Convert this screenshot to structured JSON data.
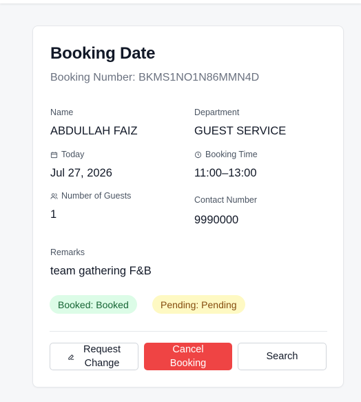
{
  "card": {
    "title": "Booking Date",
    "booking_number": "Booking Number: BKMS1NO1N86MMN4D"
  },
  "fields": {
    "name": {
      "label": "Name",
      "value": "ABDULLAH FAIZ"
    },
    "department": {
      "label": "Department",
      "value": "GUEST SERVICE"
    },
    "date": {
      "label": "Today",
      "value": "Jul 27, 2026",
      "icon": "calendar-icon"
    },
    "time": {
      "label": "Booking Time",
      "value": "11:00–13:00",
      "icon": "clock-icon"
    },
    "guests": {
      "label": "Number of Guests",
      "value": "1",
      "icon": "users-icon"
    },
    "contact": {
      "label": "Contact Number",
      "value": "9990000"
    },
    "remarks": {
      "label": "Remarks",
      "value": "team gathering F&B"
    }
  },
  "badges": {
    "booked": {
      "text": "Booked: Booked",
      "bg": "#dcfce7",
      "fg": "#166534"
    },
    "pending": {
      "text": "Pending: Pending",
      "bg": "#fef9c3",
      "fg": "#854d0e"
    }
  },
  "actions": {
    "request_line1": "Request",
    "request_line2": "Change",
    "request_icon": "edit-icon",
    "cancel_line1": "Cancel",
    "cancel_line2": "Booking",
    "cancel_color": "#ef4444",
    "search": "Search"
  }
}
